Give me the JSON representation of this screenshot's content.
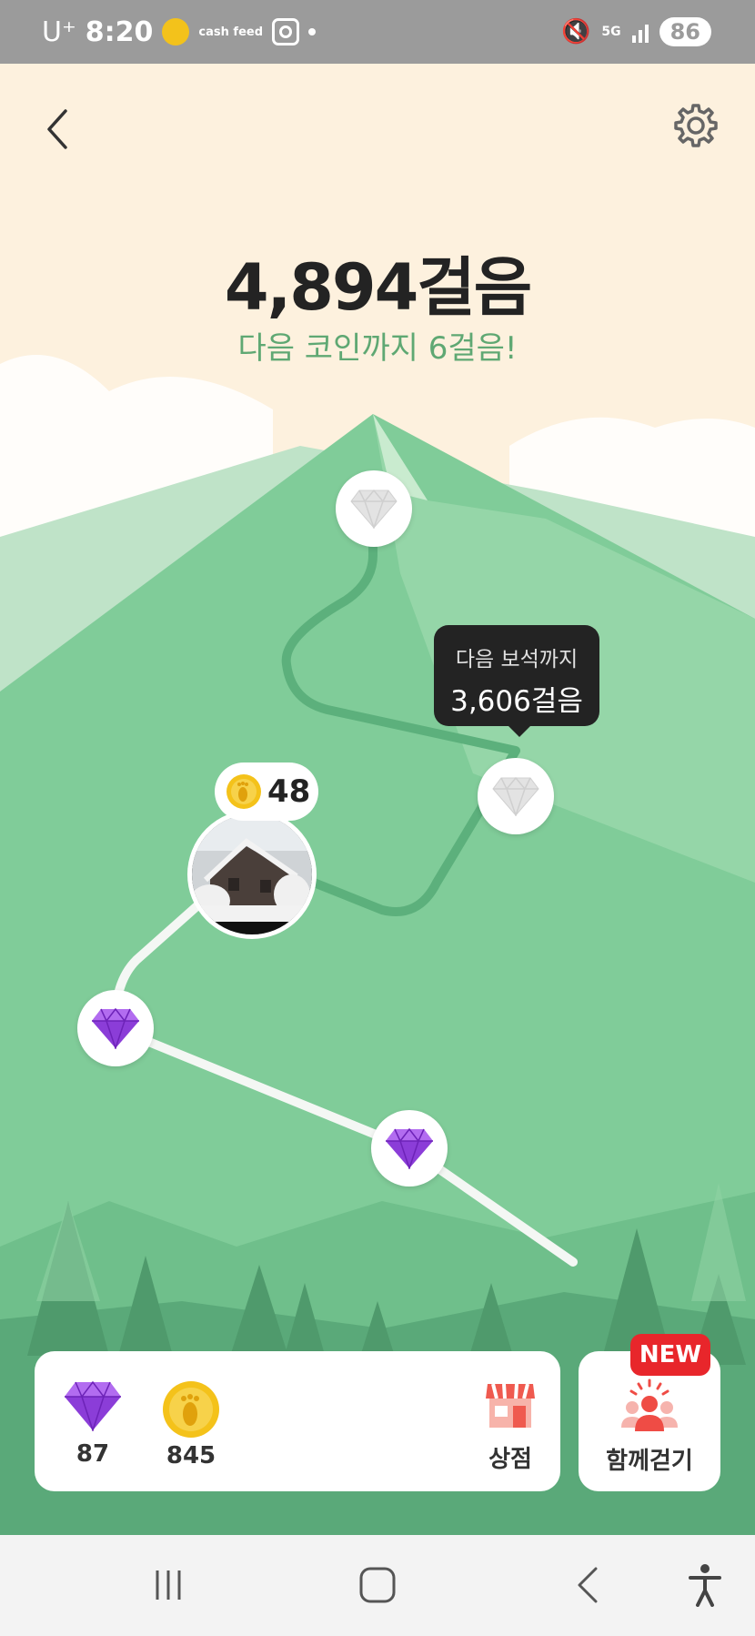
{
  "status_bar": {
    "carrier": "U⁺",
    "time": "8:20",
    "app_icon_text": "cash feed",
    "network": "5G",
    "battery": "86"
  },
  "header": {
    "back_icon": "chevron-left-icon",
    "settings_icon": "gear-icon"
  },
  "summary": {
    "steps": "4,894걸음",
    "next_coin": "다음 코인까지 6걸음!"
  },
  "tooltip": {
    "line1": "다음 보석까지",
    "line2": "3,606걸음"
  },
  "coin_badge": {
    "value": "48"
  },
  "inventory": {
    "gems": "87",
    "coins": "845",
    "shop_label": "상점"
  },
  "together": {
    "label": "함께걷기",
    "badge": "NEW"
  },
  "colors": {
    "accent_green": "#5fa873",
    "mountain": "#80cc99",
    "gem_purple": "#8b3dd8",
    "coin_gold": "#f4c21a",
    "badge_red": "#e8262b"
  }
}
